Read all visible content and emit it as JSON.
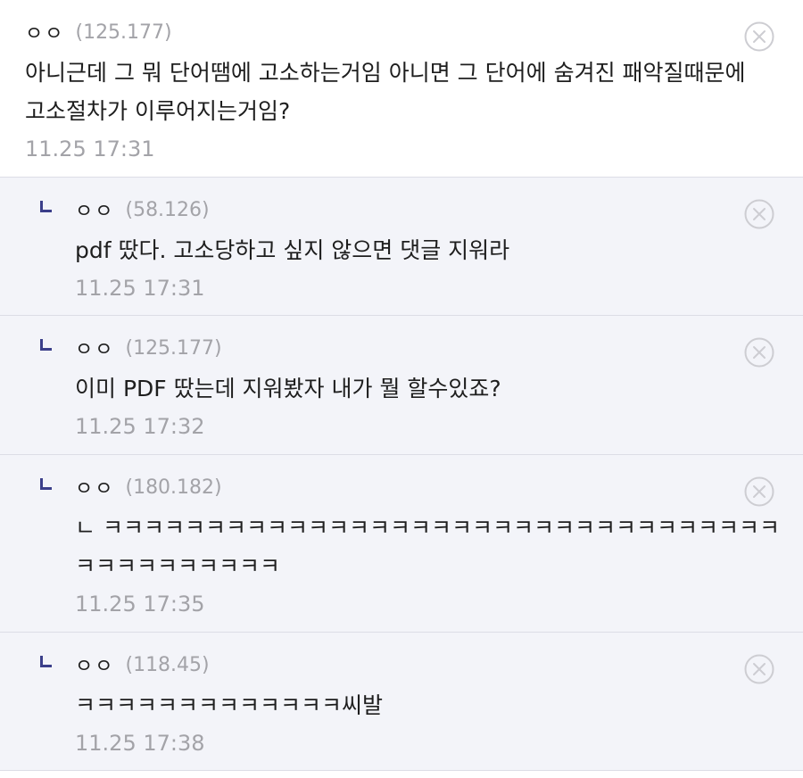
{
  "comments": [
    {
      "nick": "ㅇㅇ",
      "ip": "(125.177)",
      "text": "아니근데 그 뭐 단어땜에 고소하는거임 아니면 그 단어에 숨겨진 패악질때문에 고소절차가 이루어지는거임?",
      "date": "11.25 17:31",
      "is_reply": false
    },
    {
      "nick": "ㅇㅇ",
      "ip": "(58.126)",
      "text": "pdf 땄다. 고소당하고 싶지 않으면 댓글 지워라",
      "date": "11.25 17:31",
      "is_reply": true
    },
    {
      "nick": "ㅇㅇ",
      "ip": "(125.177)",
      "text": "이미 PDF 땄는데 지워봤자 내가 뭘 할수있죠?",
      "date": "11.25 17:32",
      "is_reply": true
    },
    {
      "nick": "ㅇㅇ",
      "ip": "(180.182)",
      "text": "ㄴ ㅋㅋㅋㅋㅋㅋㅋㅋㅋㅋㅋㅋㅋㅋㅋㅋㅋㅋㅋㅋㅋㅋㅋㅋㅋㅋㅋㅋㅋㅋㅋㅋㅋㅋㅋㅋㅋㅋㅋㅋㅋㅋㅋ",
      "date": "11.25 17:35",
      "is_reply": true
    },
    {
      "nick": "ㅇㅇ",
      "ip": "(118.45)",
      "text": "ㅋㅋㅋㅋㅋㅋㅋㅋㅋㅋㅋㅋㅋ씨발",
      "date": "11.25 17:38",
      "is_reply": true
    }
  ],
  "icons": {
    "delete": "close-circle-icon",
    "reply": "reply-arrow-icon"
  },
  "colors": {
    "reply_bg": "#f3f4f9",
    "divider": "#dcdde6",
    "meta_gray": "#a3a3a8",
    "reply_mark": "#3b3f8a",
    "text": "#1e1e1e"
  }
}
